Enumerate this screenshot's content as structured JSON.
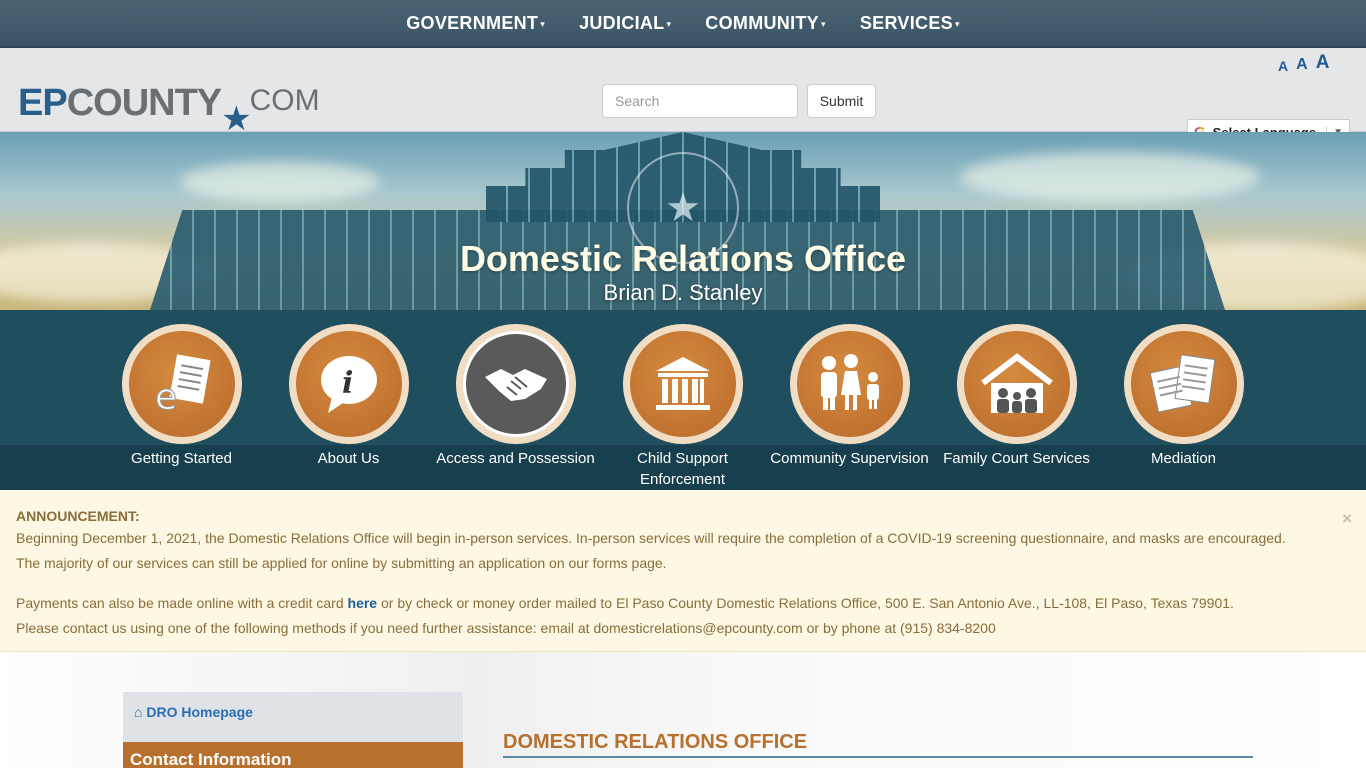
{
  "topnav": {
    "items": [
      {
        "label": "GOVERNMENT"
      },
      {
        "label": "JUDICIAL"
      },
      {
        "label": "COMMUNITY"
      },
      {
        "label": "SERVICES"
      }
    ],
    "caret": "▾"
  },
  "header": {
    "logo": {
      "ep": "EP",
      "county": "COUNTY",
      "com": "COM"
    },
    "search": {
      "placeholder": "Search"
    },
    "submit_label": "Submit",
    "font_sizes": [
      "A",
      "A",
      "A"
    ],
    "translate_label": "Select Language"
  },
  "hero": {
    "title": "Domestic Relations Office",
    "subtitle": "Brian D. Stanley"
  },
  "icon_nav": {
    "items": [
      {
        "label": "Getting Started",
        "icon": "e-document-icon"
      },
      {
        "label": "About Us",
        "icon": "info-bubble-icon"
      },
      {
        "label": "Access and Possession",
        "icon": "handshake-icon"
      },
      {
        "label": "Child Support Enforcement",
        "icon": "courthouse-icon"
      },
      {
        "label": "Community Supervision",
        "icon": "family-icon"
      },
      {
        "label": "Family Court Services",
        "icon": "house-family-icon"
      },
      {
        "label": "Mediation",
        "icon": "documents-icon"
      }
    ]
  },
  "announcement": {
    "heading": "ANNOUNCEMENT:",
    "line1": "Beginning December 1, 2021, the Domestic Relations Office will begin in-person services. In-person services will require the completion of a COVID-19 screening questionnaire, and masks are encouraged.",
    "line2": "The majority of our services can still be applied for online by submitting an application on our forms page.",
    "line3_prefix": "Payments can also be made online with a credit card ",
    "line3_link": "here",
    "line3_suffix": " or by check or money order mailed to El Paso County Domestic Relations Office, 500 E. San Antonio Ave., LL-108, El Paso, Texas 79901.",
    "line4": "Please contact us using one of the following methods if you need further assistance: email at domesticrelations@epcounty.com or by phone at (915) 834-8200",
    "close": "×"
  },
  "sidebar": {
    "home_label": "DRO Homepage",
    "contact_label": "Contact Information"
  },
  "main": {
    "section_title": "DOMESTIC RELATIONS OFFICE"
  },
  "colors": {
    "nav_bg": "#3b5566",
    "accent_orange": "#b8702e",
    "band_teal": "#1f4e5e",
    "link_blue": "#1f5c99",
    "announce_bg": "#fcf8e3"
  }
}
